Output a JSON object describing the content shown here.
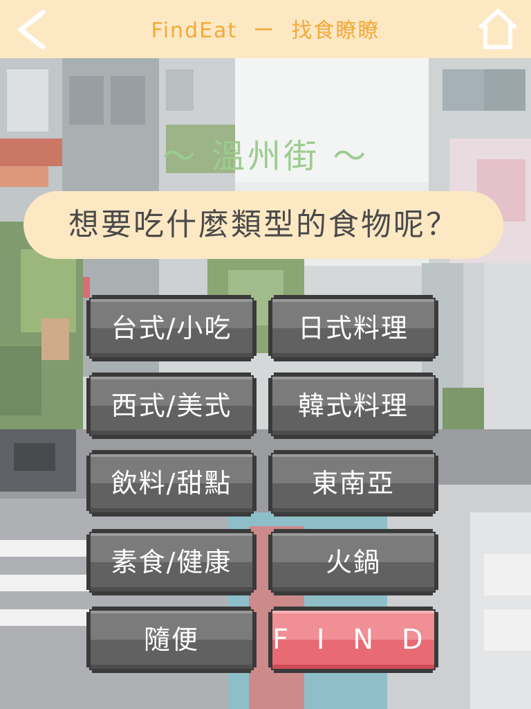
{
  "header": {
    "title": "FindEat  ー  找食瞭瞭",
    "back_icon": "back-chevron-icon",
    "home_icon": "home-icon",
    "background_color": "#fce8c3",
    "title_color": "#f4a93a"
  },
  "street": {
    "name": "～ 溫州街 ～",
    "color": "#9ccc8e"
  },
  "question": {
    "text": "想要吃什麼類型的食物呢？"
  },
  "categories": [
    {
      "label": "台式/小吃"
    },
    {
      "label": "日式料理"
    },
    {
      "label": "西式/美式"
    },
    {
      "label": "韓式料理"
    },
    {
      "label": "飲料/甜點"
    },
    {
      "label": "東南亞"
    },
    {
      "label": "素食/健康"
    },
    {
      "label": "火鍋"
    },
    {
      "label": "隨便"
    }
  ],
  "find_button": {
    "label": "F I N D !",
    "color": "#e86a73"
  }
}
